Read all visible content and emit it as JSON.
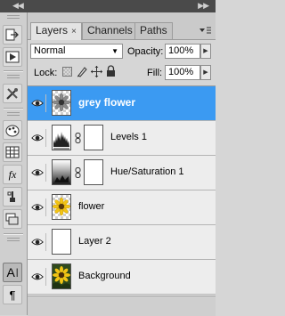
{
  "tabs": [
    {
      "label": "Layers",
      "close": "×"
    },
    {
      "label": "Channels"
    },
    {
      "label": "Paths"
    }
  ],
  "blend_mode": "Normal",
  "opacity": {
    "label": "Opacity:",
    "value": "100%"
  },
  "lock": {
    "label": "Lock:"
  },
  "fill": {
    "label": "Fill:",
    "value": "100%"
  },
  "layers": [
    {
      "name": "grey flower",
      "selected": true
    },
    {
      "name": "Levels 1"
    },
    {
      "name": "Hue/Saturation 1"
    },
    {
      "name": "flower"
    },
    {
      "name": "Layer 2"
    },
    {
      "name": "Background"
    }
  ],
  "icons": {
    "top_collapse": "double-left-arrow-icon",
    "top_expand": "double-right-arrow-icon",
    "tools": [
      "history-icon",
      "actions-icon",
      "tool-presets-icon",
      "color-icon",
      "swatches-icon",
      "styles-icon",
      "clone-source-icon",
      "layer-comps-icon",
      "character-icon",
      "paragraph-icon"
    ],
    "panel_menu": "panel-menu-icon",
    "visibility": "eye-icon",
    "link": "chain-link-icon"
  },
  "colors": {
    "selection": "#3b9af2",
    "panel_bg": "#d6d6d6",
    "topbar": "#4a4a4a"
  }
}
